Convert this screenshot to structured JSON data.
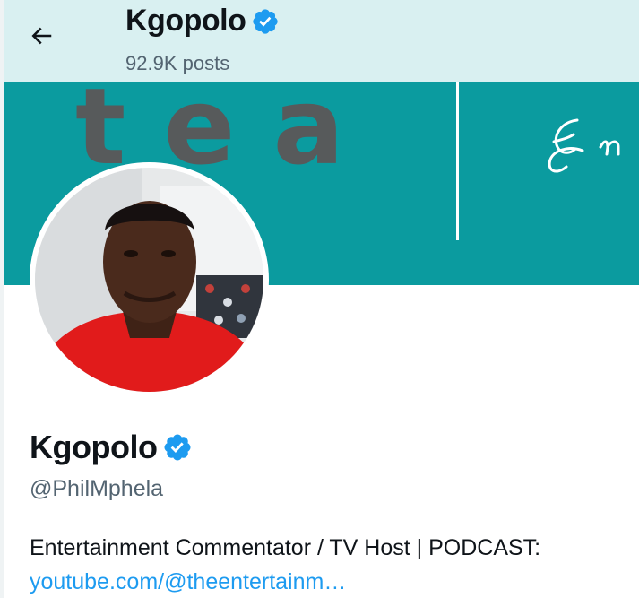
{
  "header": {
    "name": "Kgopolo",
    "posts_count": "92.9K posts",
    "back_icon": "arrow-left-icon",
    "verified_icon": "verified-badge-icon"
  },
  "banner": {
    "text": "tea",
    "script_text": "En"
  },
  "profile": {
    "name": "Kgopolo",
    "handle": "@PhilMphela",
    "bio": "Entertainment Commentator / TV Host |   PODCAST:",
    "link": "youtube.com/@theentertainm…",
    "verified_icon": "verified-badge-icon"
  },
  "colors": {
    "header_bg": "#d9f0f1",
    "banner_bg": "#0b9b9f",
    "verified_blue": "#1d9bf0",
    "link_blue": "#1d9bf0",
    "secondary_text": "#536471"
  }
}
